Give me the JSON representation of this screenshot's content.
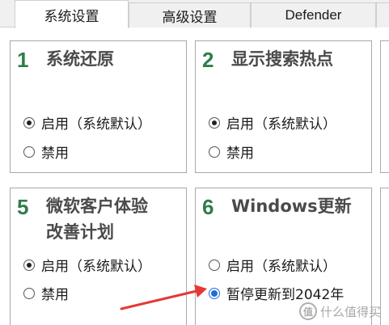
{
  "tabs": [
    {
      "label": "系统设置",
      "active": true
    },
    {
      "label": "高级设置",
      "active": false
    },
    {
      "label": "Defender",
      "active": false
    },
    {
      "label": "",
      "active": false
    }
  ],
  "cards": [
    {
      "number": "1",
      "title": "系统还原",
      "options": [
        {
          "label": "启用（系统默认）",
          "selected": true
        },
        {
          "label": "禁用",
          "selected": false
        }
      ]
    },
    {
      "number": "2",
      "title": "显示搜索热点",
      "options": [
        {
          "label": "启用（系统默认）",
          "selected": true
        },
        {
          "label": "禁用",
          "selected": false
        }
      ]
    },
    {
      "number": "5",
      "title_line1": "微软客户体验",
      "title_line2": "改善计划",
      "options": [
        {
          "label": "启用（系统默认）",
          "selected": true
        },
        {
          "label": "禁用",
          "selected": false
        }
      ]
    },
    {
      "number": "6",
      "title": "Windows更新",
      "options": [
        {
          "label": "启用（系统默认）",
          "selected": false
        },
        {
          "label": "暂停更新到2042年",
          "selected": true
        }
      ]
    }
  ],
  "annotation": {
    "arrow_color": "#e53935"
  },
  "watermark": {
    "text": "什么值得买",
    "logo": "值"
  },
  "colors": {
    "number": "#2f7d4b",
    "title": "#4a4a4a",
    "radio_accent": "#1e6fd9"
  }
}
